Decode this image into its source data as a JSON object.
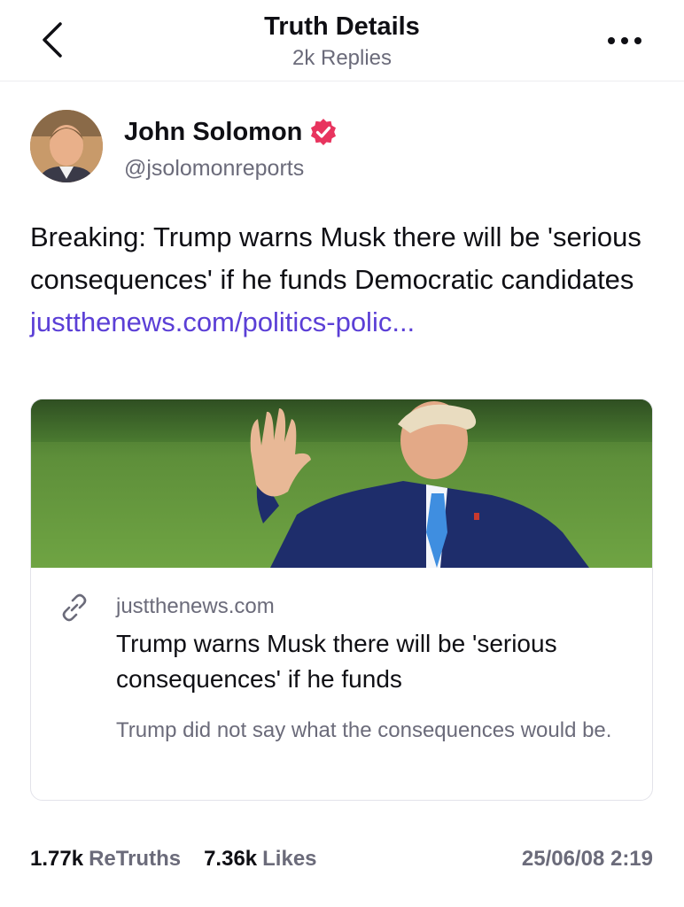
{
  "header": {
    "title": "Truth Details",
    "subtitle": "2k Replies"
  },
  "author": {
    "name": "John Solomon",
    "handle": "@jsolomonreports",
    "verified_color": "#e8345e"
  },
  "post": {
    "text": "Breaking: Trump warns Musk there will be 'serious consequences' if he funds Democratic candidates ",
    "link_text": "justthenews.com/politics-polic..."
  },
  "card": {
    "domain": "justthenews.com",
    "title": "Trump warns Musk there will be 'serious consequences' if he funds",
    "description": "Trump did not say what the consequences would be."
  },
  "stats": {
    "retruths_count": "1.77k",
    "retruths_label": "ReTruths",
    "likes_count": "7.36k",
    "likes_label": "Likes",
    "timestamp": "25/06/08 2:19"
  },
  "colors": {
    "link": "#5b3fd6",
    "muted": "#6b6b7a",
    "text": "#0f0f14"
  }
}
